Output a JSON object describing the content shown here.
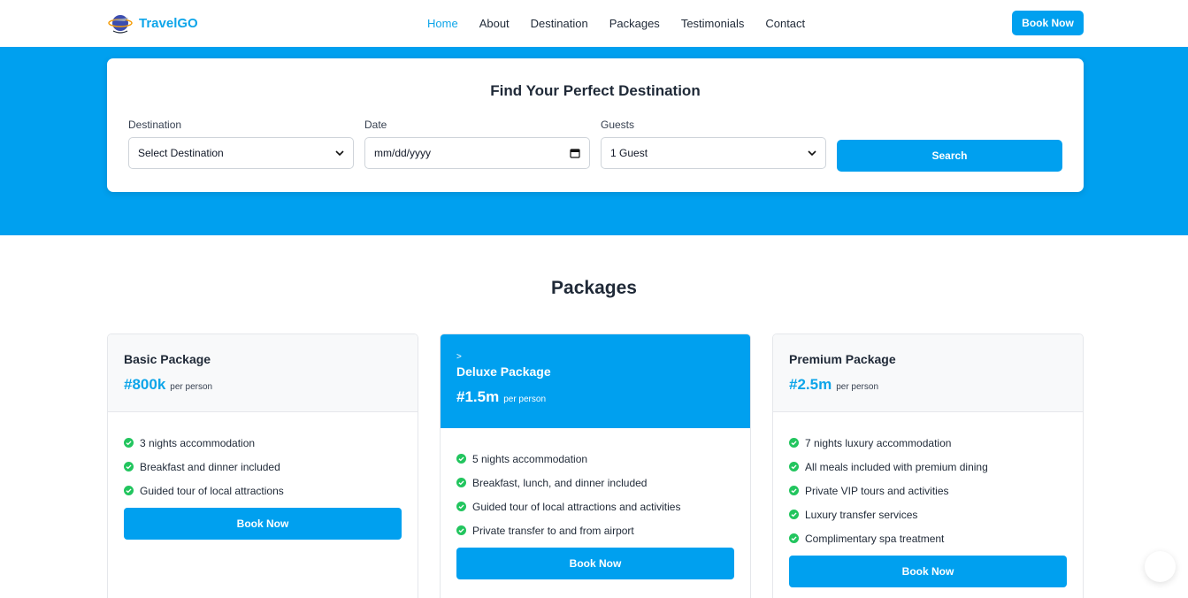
{
  "brand": {
    "name": "TravelGO",
    "logo_icon": "globe-plane-logo-icon"
  },
  "nav": {
    "links": [
      {
        "label": "Home",
        "active": true
      },
      {
        "label": "About"
      },
      {
        "label": "Destination"
      },
      {
        "label": "Packages"
      },
      {
        "label": "Testimonials"
      },
      {
        "label": "Contact"
      }
    ],
    "book_label": "Book Now"
  },
  "search": {
    "title": "Find Your Perfect Destination",
    "destination": {
      "label": "Destination",
      "value": "Select Destination"
    },
    "date": {
      "label": "Date",
      "value": "mm/dd/yyyy"
    },
    "guests": {
      "label": "Guests",
      "value": "1 Guest"
    },
    "button": "Search"
  },
  "packages": {
    "title": "Packages",
    "items": [
      {
        "name": "Basic Package",
        "price": "#800k",
        "per": "per person",
        "features": [
          "3 nights accommodation",
          "Breakfast and dinner included",
          "Guided tour of local attractions"
        ],
        "button": "Book Now"
      },
      {
        "marker": ">",
        "name": "Deluxe Package",
        "price": "#1.5m",
        "per": "per person",
        "features": [
          "5 nights accommodation",
          "Breakfast, lunch, and dinner included",
          "Guided tour of local attractions and activities",
          "Private transfer to and from airport"
        ],
        "button": "Book Now"
      },
      {
        "name": "Premium Package",
        "price": "#2.5m",
        "per": "per person",
        "features": [
          "7 nights luxury accommodation",
          "All meals included with premium dining",
          "Private VIP tours and activities",
          "Luxury transfer services",
          "Complimentary spa treatment"
        ],
        "button": "Book Now"
      }
    ]
  },
  "colors": {
    "primary": "#00a0ef",
    "accent_text": "#0ea5e9",
    "check": "#22c55e"
  }
}
